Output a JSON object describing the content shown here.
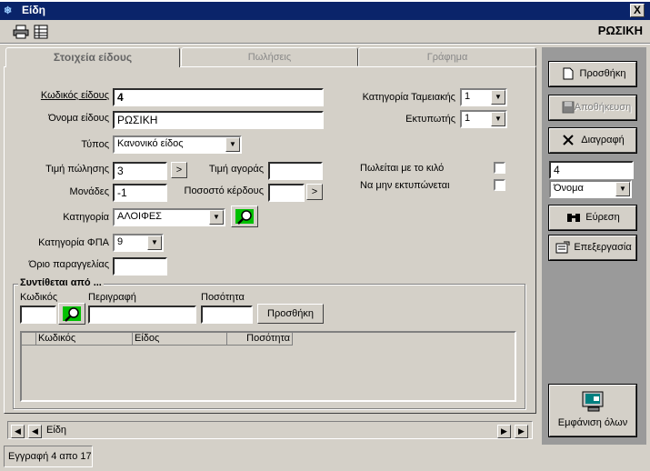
{
  "window": {
    "title": "Είδη",
    "close": "X"
  },
  "record_title": "ΡΩΣΙΚΗ",
  "tabs": [
    {
      "label": "Στοιχεία είδους",
      "active": true
    },
    {
      "label": "Πωλήσεις",
      "active": false
    },
    {
      "label": "Γράφημα",
      "active": false
    }
  ],
  "form": {
    "code_label": "Κωδικός είδους",
    "code_value": "4",
    "name_label": "Όνομα είδους",
    "name_value": "ΡΩΣΙΚΗ",
    "type_label": "Τύπος",
    "type_value": "Κανονικό είδος",
    "sale_price_label": "Τιμή πώλησης",
    "sale_price_value": "3",
    "purchase_price_label": "Τιμή αγοράς",
    "purchase_price_value": "",
    "units_label": "Μονάδες",
    "units_value": "-1",
    "profit_pct_label": "Ποσοστό κέρδους",
    "profit_pct_value": "",
    "arrow_btn": ">",
    "category_label": "Κατηγορία",
    "category_value": "ΑΛΟΙΦΕΣ",
    "vat_label": "Κατηγορία ΦΠΑ",
    "vat_value": "9",
    "order_limit_label": "Όριο παραγγελίας",
    "order_limit_value": "",
    "cash_cat_label": "Κατηγορία Ταμειακής",
    "cash_cat_value": "1",
    "printer_label": "Εκτυπωτής",
    "printer_value": "1",
    "sold_by_kilo_label": "Πωλείται με το κιλό",
    "not_printed_label": "Να μην εκτυπώνεται"
  },
  "composition": {
    "title": "Συντίθεται από ...",
    "code_label": "Κωδικός",
    "desc_label": "Περιγραφή",
    "qty_label": "Ποσότητα",
    "add_button": "Προσθήκη",
    "columns": [
      "Κωδικός",
      "Είδος",
      "Ποσότητα"
    ],
    "rows": []
  },
  "sidebar": {
    "add": "Προσθήκη",
    "save": "Αποθήκευση",
    "delete": "Διαγραφή",
    "search_value": "4",
    "search_field": "Όνομα",
    "find": "Εύρεση",
    "edit": "Επεξεργασία",
    "show_all": "Εμφάνιση όλων"
  },
  "nav": {
    "label": "Είδη"
  },
  "status": "Εγγραφή 4 απο 17",
  "colors": {
    "titlebar": "#0a246a",
    "face": "#d4d0c8",
    "sidebar": "#9a9a9a",
    "search_green": "#00c000"
  }
}
